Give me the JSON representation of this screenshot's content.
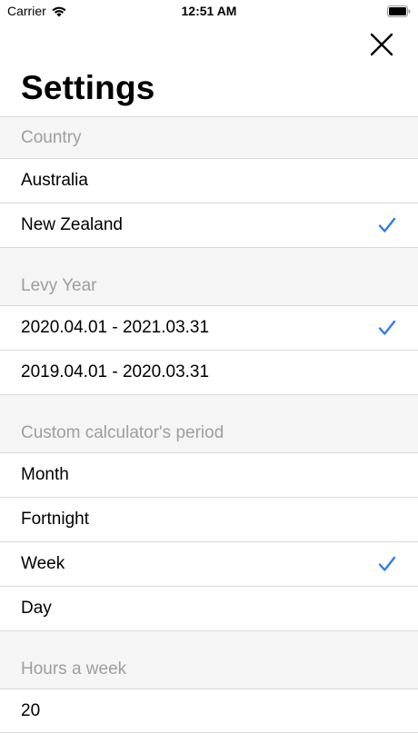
{
  "status_bar": {
    "carrier": "Carrier",
    "time": "12:51 AM",
    "wifi_icon": "wifi-icon",
    "battery_icon": "battery-icon"
  },
  "header": {
    "title": "Settings",
    "close_icon": "close-icon"
  },
  "accent_color": "#2f7cf6",
  "sections": {
    "country": {
      "header": "Country",
      "items": [
        {
          "label": "Australia",
          "selected": false
        },
        {
          "label": "New Zealand",
          "selected": true
        }
      ]
    },
    "levy_year": {
      "header": "Levy Year",
      "items": [
        {
          "label": "2020.04.01 - 2021.03.31",
          "selected": true
        },
        {
          "label": "2019.04.01 - 2020.03.31",
          "selected": false
        }
      ]
    },
    "period": {
      "header": "Custom calculator's period",
      "items": [
        {
          "label": "Month",
          "selected": false
        },
        {
          "label": "Fortnight",
          "selected": false
        },
        {
          "label": "Week",
          "selected": true
        },
        {
          "label": "Day",
          "selected": false
        }
      ]
    },
    "hours": {
      "header": "Hours a week",
      "items": [
        {
          "label": "20",
          "selected": false
        }
      ]
    }
  }
}
